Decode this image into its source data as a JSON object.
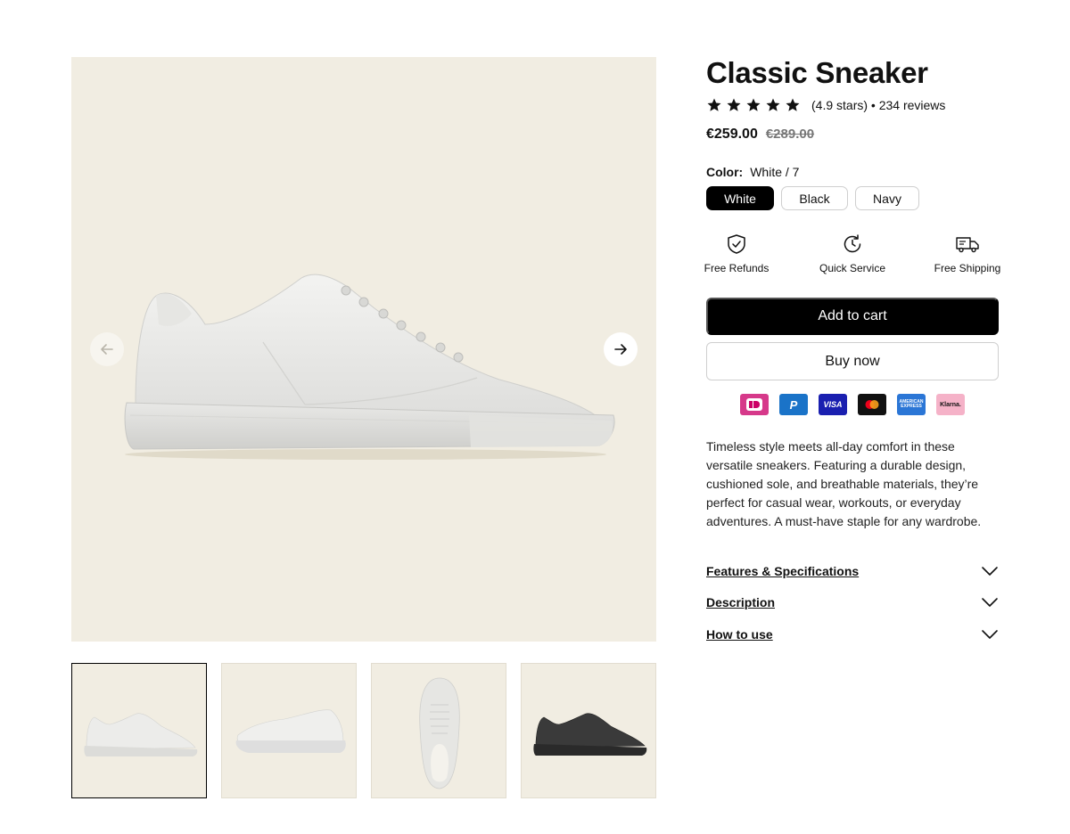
{
  "gallery": {
    "prev_icon": "arrow-left-icon",
    "next_icon": "arrow-right-icon",
    "background": "#f1ede2",
    "thumbnail_count": 4,
    "active_thumbnail": 1
  },
  "product": {
    "title": "Classic Sneaker",
    "rating": {
      "stars": 5,
      "text": "(4.9 stars) • 234 reviews"
    },
    "price": "€259.00",
    "old_price": "€289.00"
  },
  "color": {
    "label": "Color:",
    "value": "White / 7",
    "options": [
      "White",
      "Black",
      "Navy"
    ],
    "selected": "White"
  },
  "features": [
    {
      "label": "Free Refunds",
      "icon": "shield-check-icon"
    },
    {
      "label": "Quick Service",
      "icon": "clock-refresh-icon"
    },
    {
      "label": "Free Shipping",
      "icon": "truck-icon"
    }
  ],
  "actions": {
    "add_to_cart": "Add to cart",
    "buy_now": "Buy now"
  },
  "payments": [
    {
      "name": "iDEAL",
      "icon": "ideal-icon",
      "color": "#cc0066"
    },
    {
      "name": "PayPal",
      "icon": "paypal-icon",
      "color": "#1a73c8"
    },
    {
      "name": "VISA",
      "icon": "visa-icon",
      "color": "#1a1fb0"
    },
    {
      "name": "Mastercard",
      "icon": "mastercard-icon",
      "color": "#111111"
    },
    {
      "name": "AMERICAN EXPRESS",
      "icon": "amex-icon",
      "color": "#2b76d6"
    },
    {
      "name": "Klarna.",
      "icon": "klarna-icon",
      "color": "#f5b2c8"
    }
  ],
  "description": "Timeless style meets all-day comfort in these versatile sneakers. Featuring a durable design, cushioned sole, and breathable materials, they’re perfect for casual wear, workouts, or everyday adventures. A must-have staple for any wardrobe.",
  "accordions": [
    {
      "label": "Features & Specifications",
      "icon": "chevron-down-icon"
    },
    {
      "label": "Description",
      "icon": "chevron-down-icon"
    },
    {
      "label": "How to use",
      "icon": "chevron-down-icon"
    }
  ]
}
